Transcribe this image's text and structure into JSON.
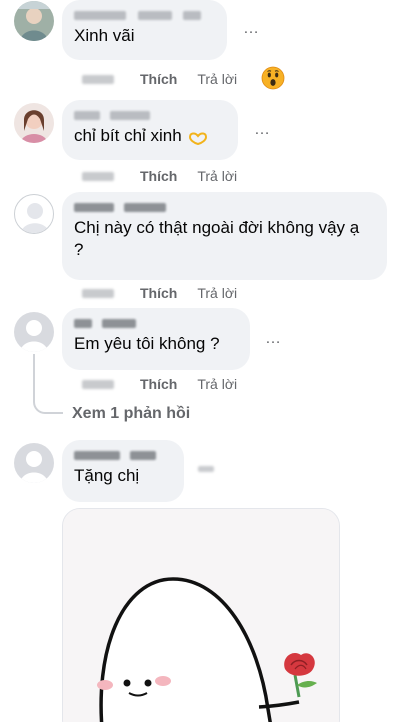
{
  "comments": [
    {
      "id": "c1",
      "text": "Xinh vãi",
      "actions": {
        "like": "Thích",
        "reply": "Trả lời"
      },
      "reaction": "wow-emoji"
    },
    {
      "id": "c2",
      "text": "chỉ bít chỉ xinh",
      "emoji": "heart-hands-emoji",
      "actions": {
        "like": "Thích",
        "reply": "Trả lời"
      }
    },
    {
      "id": "c3",
      "text": "Chị này có thật ngoài đời không vậy ạ ?",
      "actions": {
        "like": "Thích",
        "reply": "Trả lời"
      }
    },
    {
      "id": "c4",
      "text": "Em yêu tôi không ?",
      "actions": {
        "like": "Thích",
        "reply": "Trả lời"
      },
      "view_replies": "Xem 1 phản hồi"
    },
    {
      "id": "c5",
      "text": "Tặng chị",
      "sticker": "ghost-holding-rose-sticker"
    }
  ],
  "more_icon": "…",
  "colors": {
    "bubble": "#f0f2f5",
    "secondary_text": "#65676b",
    "primary_text": "#050505"
  }
}
